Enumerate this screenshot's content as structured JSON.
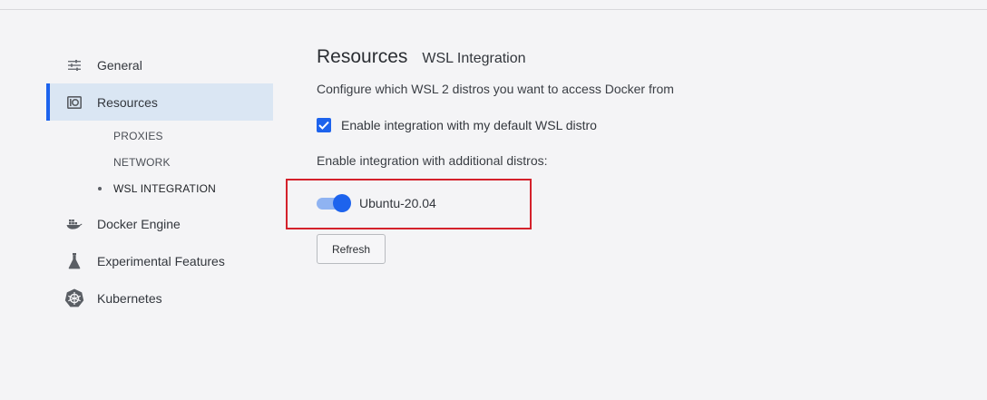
{
  "sidebar": {
    "items": [
      {
        "label": "General",
        "icon": "sliders-icon"
      },
      {
        "label": "Resources",
        "icon": "resources-icon",
        "active": true
      },
      {
        "label": "Docker Engine",
        "icon": "whale-icon"
      },
      {
        "label": "Experimental Features",
        "icon": "flask-icon"
      },
      {
        "label": "Kubernetes",
        "icon": "helm-wheel-icon"
      }
    ],
    "subitems": [
      {
        "label": "PROXIES"
      },
      {
        "label": "NETWORK"
      },
      {
        "label": "WSL INTEGRATION",
        "current": true
      }
    ]
  },
  "main": {
    "title": "Resources",
    "subtitle": "WSL Integration",
    "description": "Configure which WSL 2 distros you want to access Docker from",
    "default_distro": {
      "label": "Enable integration with my default WSL distro",
      "checked": true
    },
    "additional_label": "Enable integration with additional distros:",
    "distros": [
      {
        "name": "Ubuntu-20.04",
        "enabled": true
      }
    ],
    "refresh_label": "Refresh"
  },
  "colors": {
    "accent": "#1d63ed",
    "active_bg": "#dae6f3",
    "highlight_border": "#d4212b",
    "background": "#f4f4f6"
  }
}
